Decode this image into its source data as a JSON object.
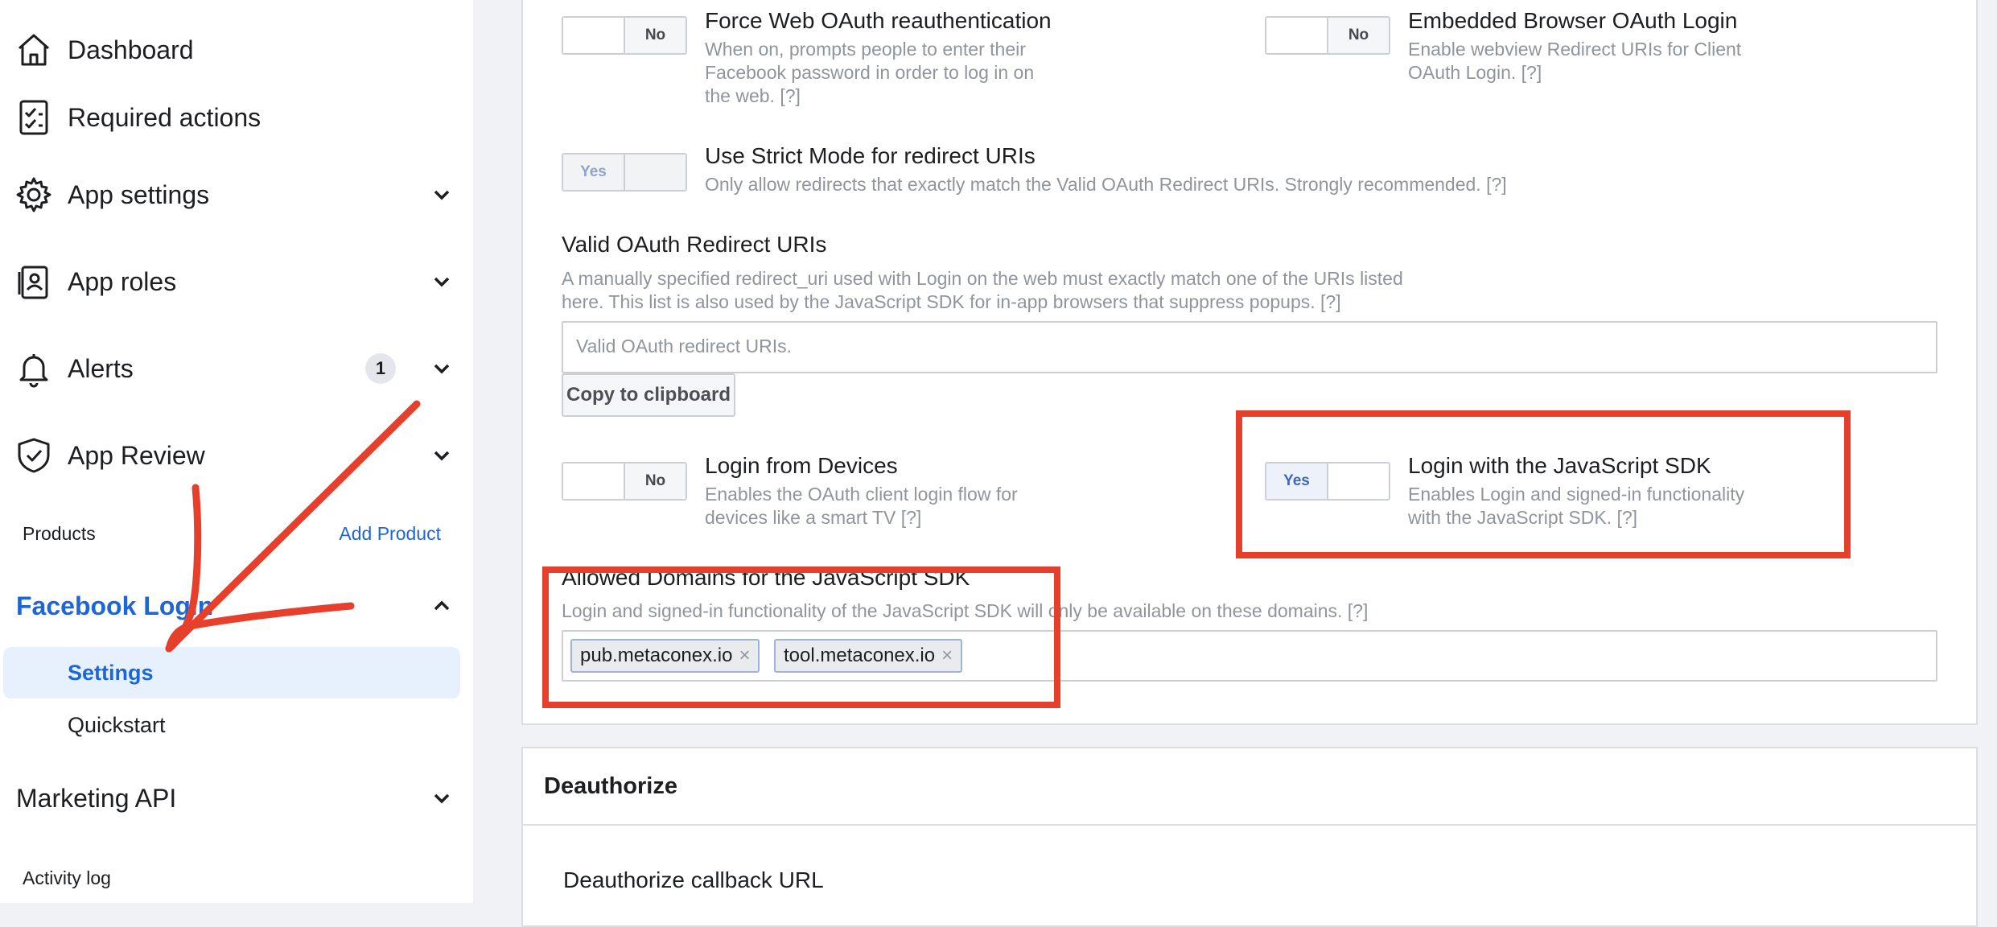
{
  "sidebar": {
    "items": [
      {
        "label": "Dashboard",
        "icon": "home-icon"
      },
      {
        "label": "Required actions",
        "icon": "checklist-icon"
      },
      {
        "label": "App settings",
        "icon": "gear-icon"
      },
      {
        "label": "App roles",
        "icon": "id-badge-icon"
      },
      {
        "label": "Alerts",
        "icon": "bell-icon",
        "badge": "1"
      },
      {
        "label": "App Review",
        "icon": "shield-check-icon"
      }
    ],
    "products_label": "Products",
    "add_product": "Add Product",
    "facebook_login": "Facebook Login",
    "sub_items": [
      "Settings",
      "Quickstart"
    ],
    "marketing_api": "Marketing API",
    "activity_log": "Activity log"
  },
  "settings": {
    "force_reauth": {
      "title": "Force Web OAuth reauthentication",
      "desc": [
        "When on, prompts people to enter their",
        "Facebook password in order to log in on",
        "the web.  [?]"
      ],
      "toggle": "No"
    },
    "embedded_browser": {
      "title": "Embedded Browser OAuth Login",
      "desc": [
        "Enable webview Redirect URIs for Client",
        "OAuth Login.  [?]"
      ],
      "toggle": "No"
    },
    "strict_mode": {
      "title": "Use Strict Mode for redirect URIs",
      "desc": [
        "Only allow redirects that exactly match the Valid OAuth Redirect URIs. Strongly recommended.  [?]"
      ],
      "toggle": "Yes"
    },
    "valid_redirects": {
      "title": "Valid OAuth Redirect URIs",
      "desc": [
        "A manually specified redirect_uri used with Login on the web must exactly match one of the URIs listed",
        "here. This list is also used by the JavaScript SDK for in-app browsers that suppress popups.  [?]"
      ],
      "placeholder": "Valid OAuth redirect URIs.",
      "copy_button": "Copy to clipboard"
    },
    "login_devices": {
      "title": "Login from Devices",
      "desc": [
        "Enables the OAuth client login flow for",
        "devices like a smart TV [?]"
      ],
      "toggle": "No"
    },
    "login_js_sdk": {
      "title": "Login with the JavaScript SDK",
      "desc": [
        "Enables Login and signed-in functionality",
        "with the JavaScript SDK.  [?]"
      ],
      "toggle": "Yes"
    },
    "allowed_domains": {
      "title": "Allowed Domains for the JavaScript SDK",
      "desc": "Login and signed-in functionality of the JavaScript SDK will only be available on these domains.  [?]",
      "domains": [
        "pub.metaconex.io",
        "tool.metaconex.io"
      ],
      "remove_glyph": "×"
    }
  },
  "deauthorize": {
    "header": "Deauthorize",
    "callback_label": "Deauthorize callback URL"
  },
  "colors": {
    "annotation_red": "#e6402c",
    "link_blue": "#1d66d8"
  }
}
